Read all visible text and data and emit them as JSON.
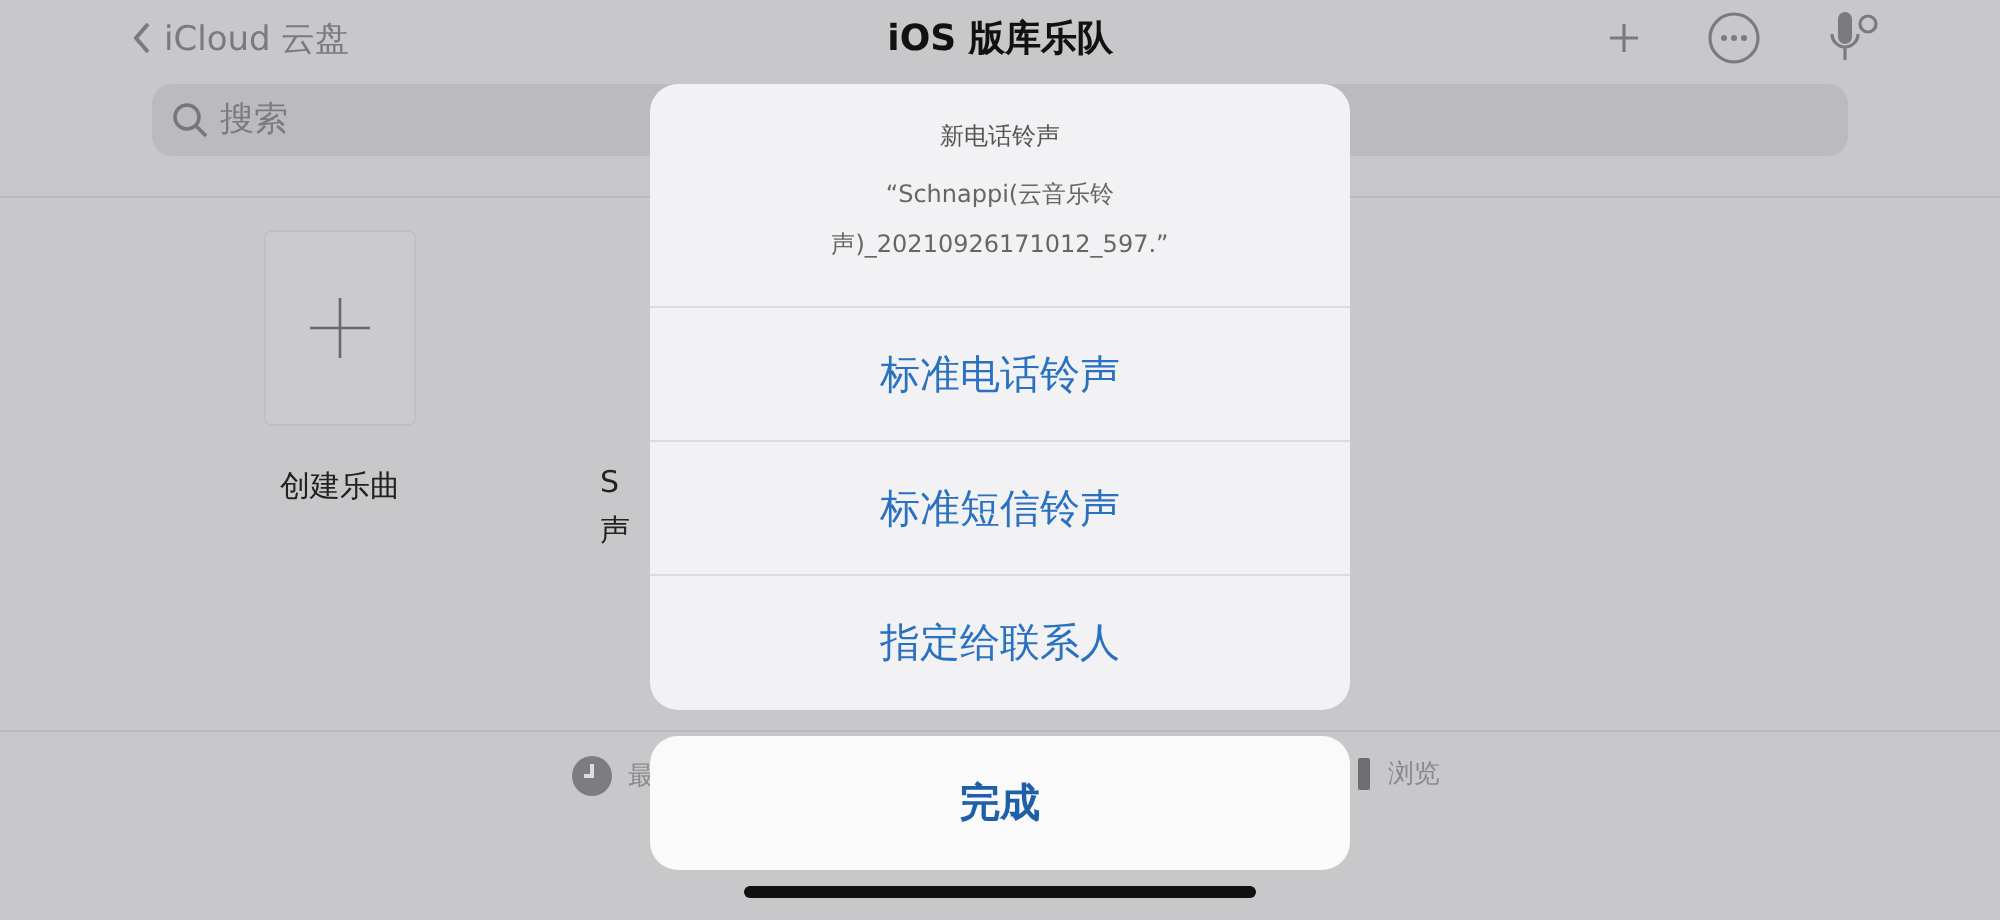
{
  "nav": {
    "back_label": "iCloud 云盘",
    "title": "iOS 版库乐队"
  },
  "search": {
    "placeholder": "搜索"
  },
  "files": [
    {
      "kind": "create",
      "label_lines": [
        "创建乐曲"
      ]
    },
    {
      "kind": "partial",
      "label_lines": [
        "S",
        "声"
      ]
    }
  ],
  "tab_bar": [
    {
      "label": "最",
      "kind": "recents"
    },
    {
      "label": "浏览",
      "kind": "browse"
    }
  ],
  "sheet": {
    "title": "新电话铃声",
    "message_lines": [
      "“Schnappi(云音乐铃",
      "声)_20210926171012_597.”"
    ],
    "actions": [
      "标准电话铃声",
      "标准短信铃声",
      "指定给联系人"
    ],
    "done": "完成"
  }
}
